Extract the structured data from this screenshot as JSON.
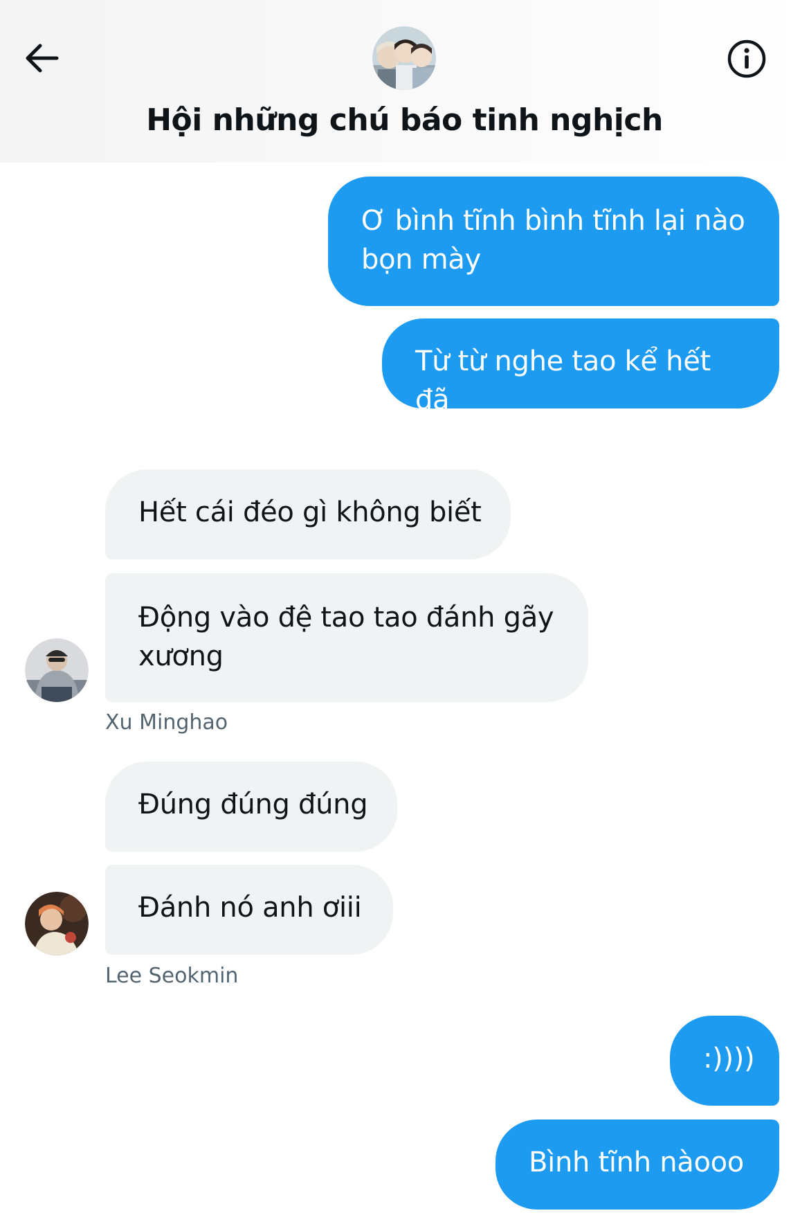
{
  "header": {
    "title": "Hội những chú báo tinh nghịch",
    "back_icon": "arrow-left-icon",
    "info_icon": "info-circle-icon"
  },
  "messages": [
    {
      "text": "Ơ bình tĩnh bình tĩnh lại nào bọn mày",
      "direction": "outgoing"
    },
    {
      "text": "Từ từ nghe tao kể hết đã",
      "direction": "outgoing"
    },
    {
      "text": "Hết cái đéo gì không biết",
      "direction": "incoming"
    },
    {
      "text": "Động vào đệ tao tao đánh gãy xương",
      "direction": "incoming"
    },
    {
      "text": "Xu Minghao",
      "kind": "sender_name"
    },
    {
      "text": "Đúng đúng đúng",
      "direction": "incoming"
    },
    {
      "text": "Đánh nó anh ơiii",
      "direction": "incoming"
    },
    {
      "text": "Lee Seokmin",
      "kind": "sender_name"
    },
    {
      "text": ":))))",
      "direction": "outgoing"
    },
    {
      "text": "Bình tĩnh nàooo",
      "direction": "outgoing"
    }
  ],
  "colors": {
    "outgoing_bubble": "#1d9bf0",
    "incoming_bubble": "#eff3f4",
    "sender_name": "#536471",
    "title": "#0f1419"
  }
}
